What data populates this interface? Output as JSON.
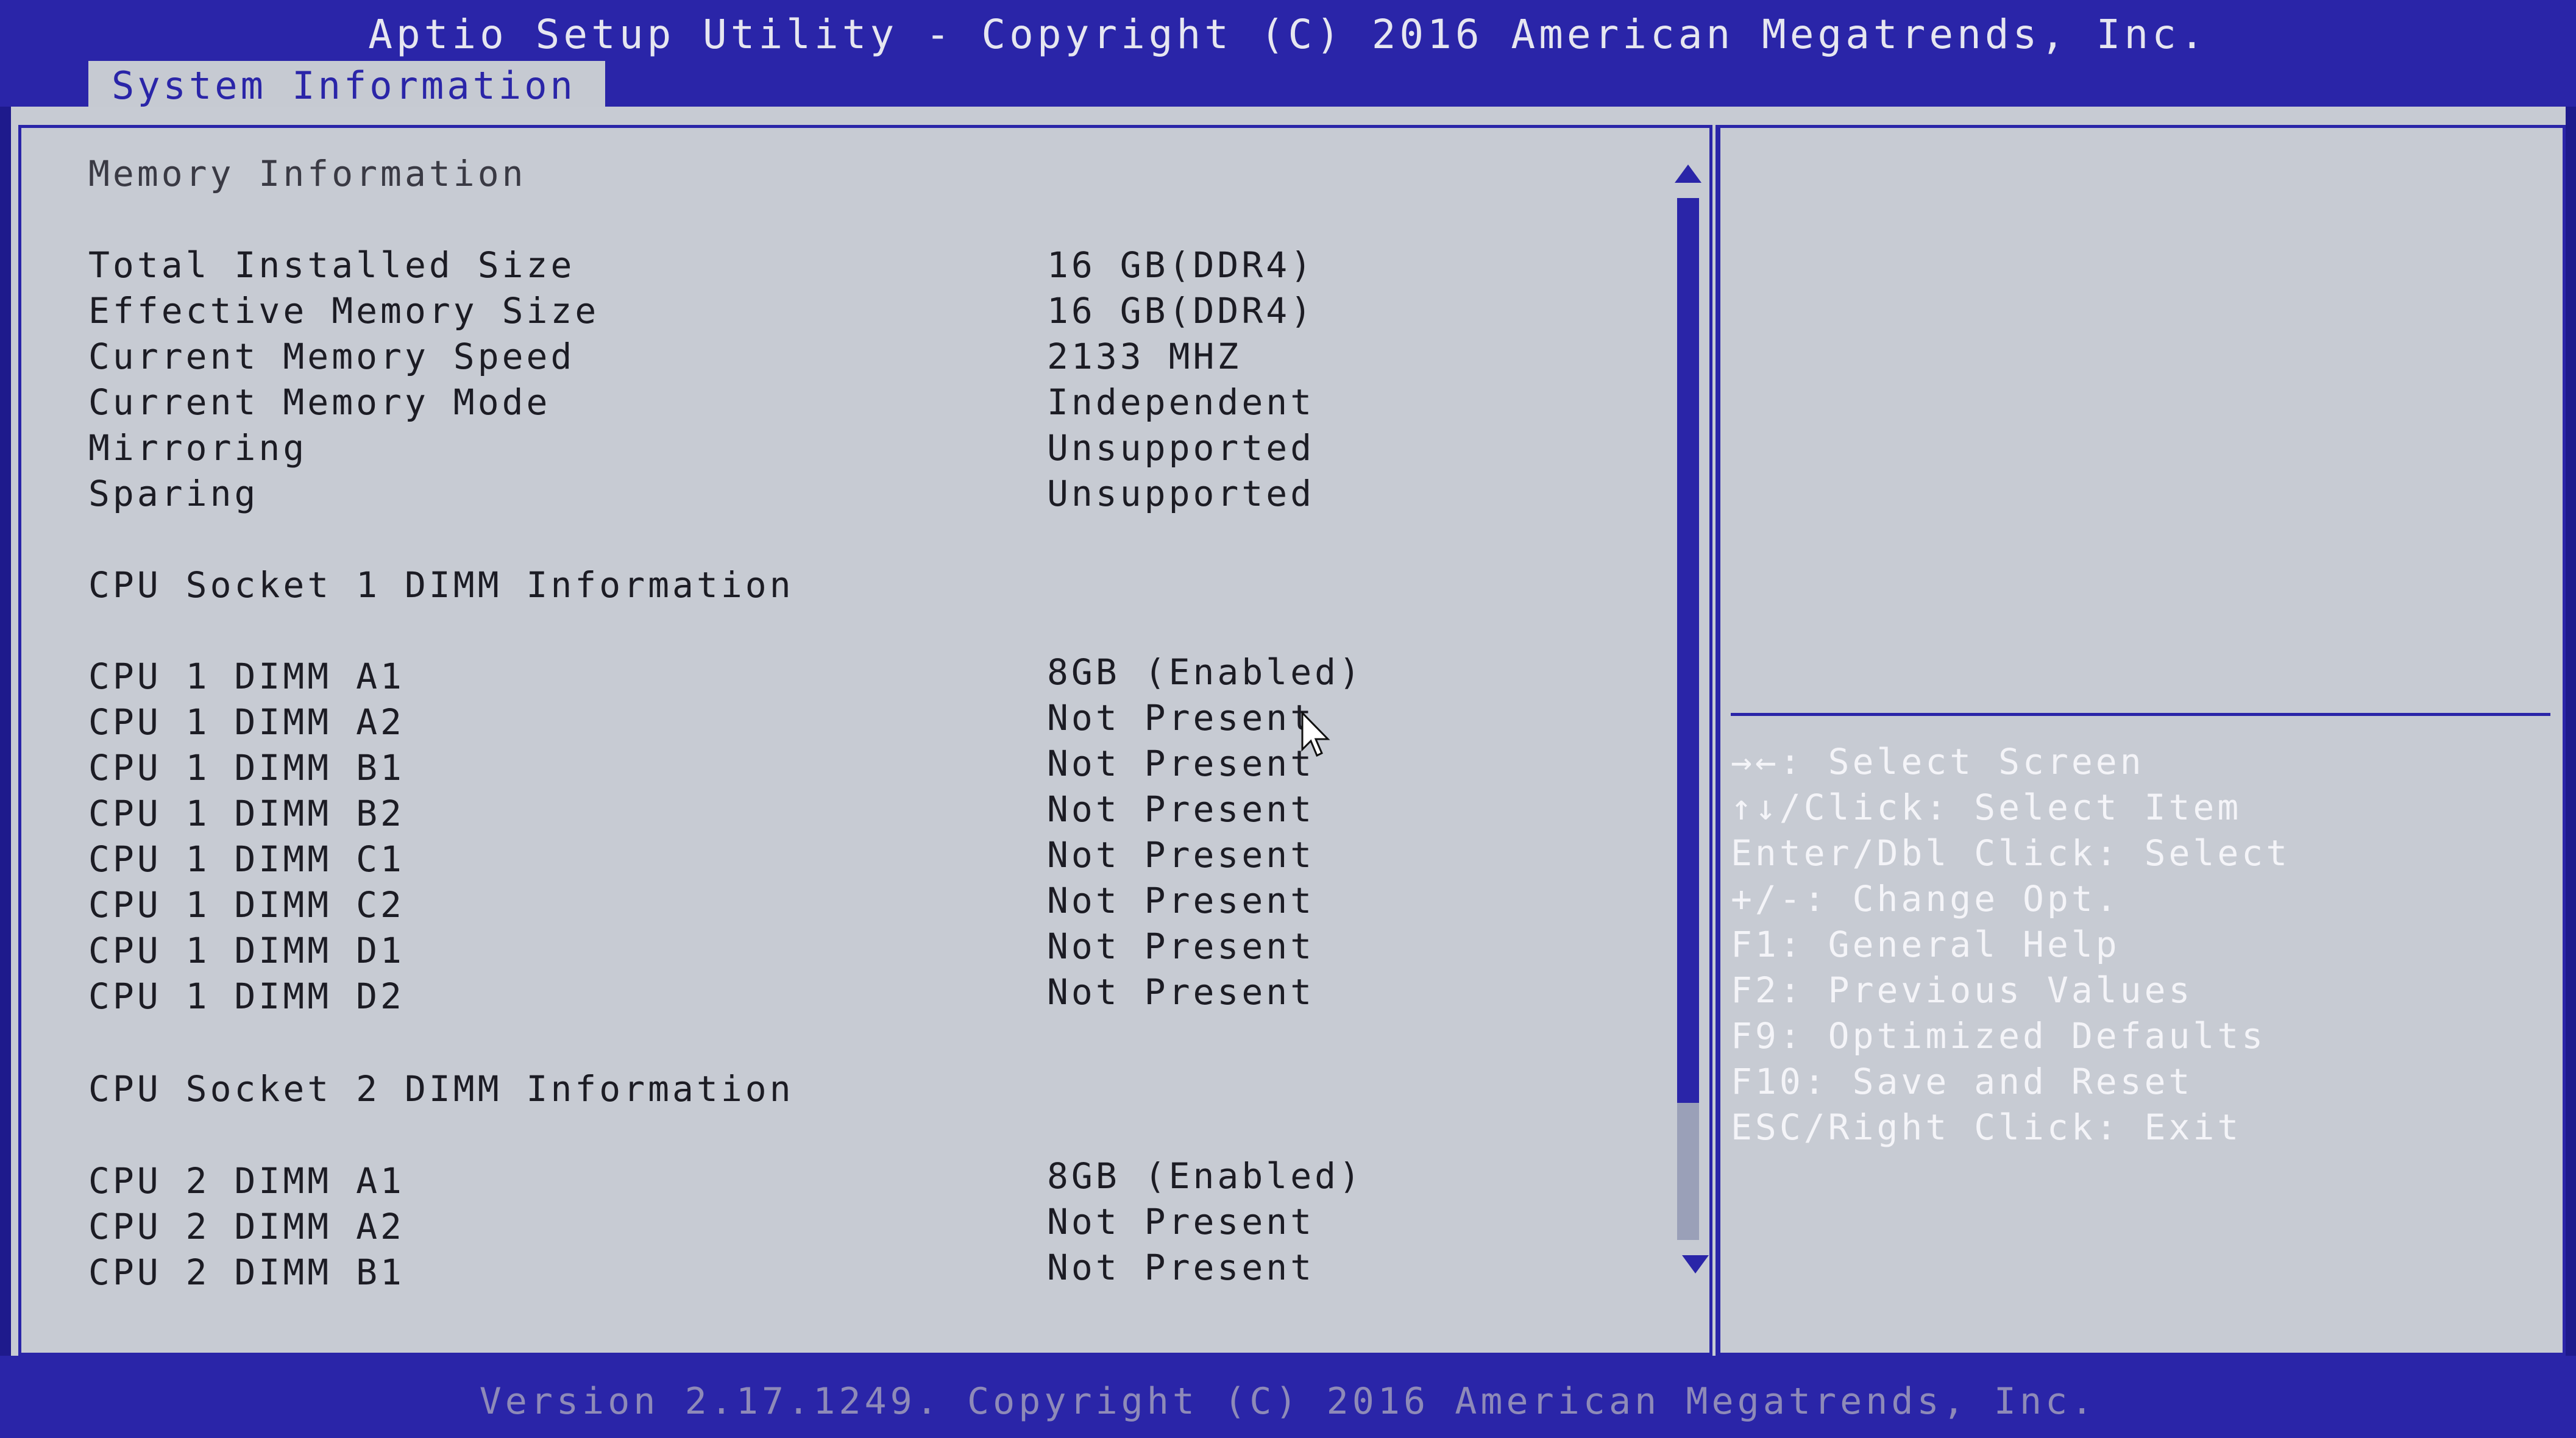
{
  "header": {
    "title": "Aptio Setup Utility - Copyright (C) 2016 American Megatrends, Inc.",
    "active_tab": "System Information"
  },
  "main": {
    "memory_section": "Memory Information",
    "memory": [
      {
        "label": "Total Installed Size",
        "value": "16 GB(DDR4)"
      },
      {
        "label": "Effective Memory Size",
        "value": "16 GB(DDR4)"
      },
      {
        "label": "Current Memory Speed",
        "value": "2133 MHZ"
      },
      {
        "label": "Current Memory Mode",
        "value": "Independent"
      },
      {
        "label": "Mirroring",
        "value": "Unsupported"
      },
      {
        "label": "Sparing",
        "value": "Unsupported"
      }
    ],
    "socket1_section": "CPU Socket 1 DIMM Information",
    "socket1": [
      {
        "label": "CPU 1 DIMM A1",
        "value": "8GB (Enabled)"
      },
      {
        "label": "CPU 1 DIMM A2",
        "value": "Not Present"
      },
      {
        "label": "CPU 1 DIMM B1",
        "value": "Not Present"
      },
      {
        "label": "CPU 1 DIMM B2",
        "value": "Not Present"
      },
      {
        "label": "CPU 1 DIMM C1",
        "value": "Not Present"
      },
      {
        "label": "CPU 1 DIMM C2",
        "value": "Not Present"
      },
      {
        "label": "CPU 1 DIMM D1",
        "value": "Not Present"
      },
      {
        "label": "CPU 1 DIMM D2",
        "value": "Not Present"
      }
    ],
    "socket2_section": "CPU Socket 2 DIMM Information",
    "socket2": [
      {
        "label": "CPU 2 DIMM A1",
        "value": "8GB (Enabled)"
      },
      {
        "label": "CPU 2 DIMM A2",
        "value": "Not Present"
      },
      {
        "label": "CPU 2 DIMM B1",
        "value": "Not Present"
      }
    ]
  },
  "help": [
    "→←: Select Screen",
    "↑↓/Click: Select Item",
    "Enter/Dbl Click: Select",
    "+/-: Change Opt.",
    "F1: General Help",
    "F2: Previous Values",
    "F9: Optimized Defaults",
    "F10: Save and Reset",
    "ESC/Right Click: Exit"
  ],
  "footer": {
    "version": "Version 2.17.1249. Copyright (C) 2016 American Megatrends, Inc."
  },
  "colors": {
    "accent": "#2a25a8",
    "panel": "#c7cbd3",
    "help_text": "#f4f4f8"
  }
}
